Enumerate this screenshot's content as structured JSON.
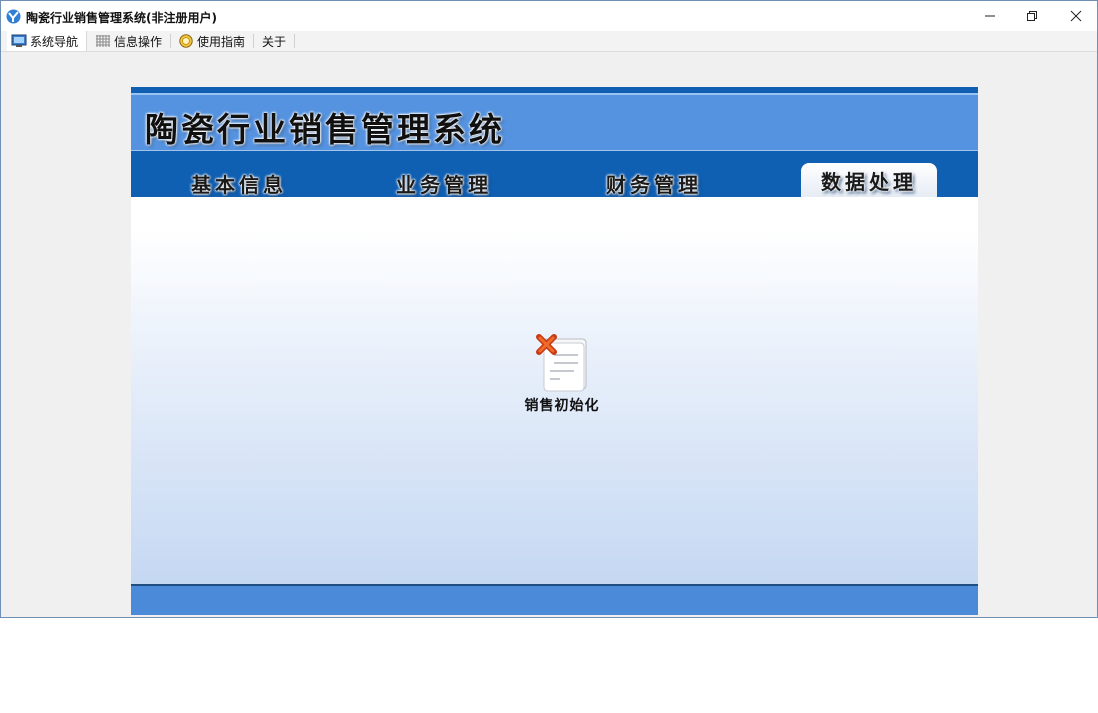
{
  "window": {
    "title": "陶瓷行业销售管理系统(非注册用户)"
  },
  "toolbar": {
    "tabs": [
      {
        "label": "系统导航",
        "icon": "monitor-icon"
      },
      {
        "label": "信息操作",
        "icon": "grid-icon"
      },
      {
        "label": "使用指南",
        "icon": "help-coin-icon"
      },
      {
        "label": "关于",
        "icon": ""
      }
    ]
  },
  "banner": {
    "title": "陶瓷行业销售管理系统"
  },
  "nav": {
    "items": [
      "基本信息",
      "业务管理",
      "财务管理",
      "数据处理"
    ],
    "active": "数据处理"
  },
  "main": {
    "items": [
      {
        "label": "销售初始化",
        "icon": "document-delete-icon"
      }
    ]
  },
  "colors": {
    "nav_bg": "#0f5fb3",
    "banner_bg": "#5593e0",
    "footer_bg": "#4a8ad8"
  }
}
